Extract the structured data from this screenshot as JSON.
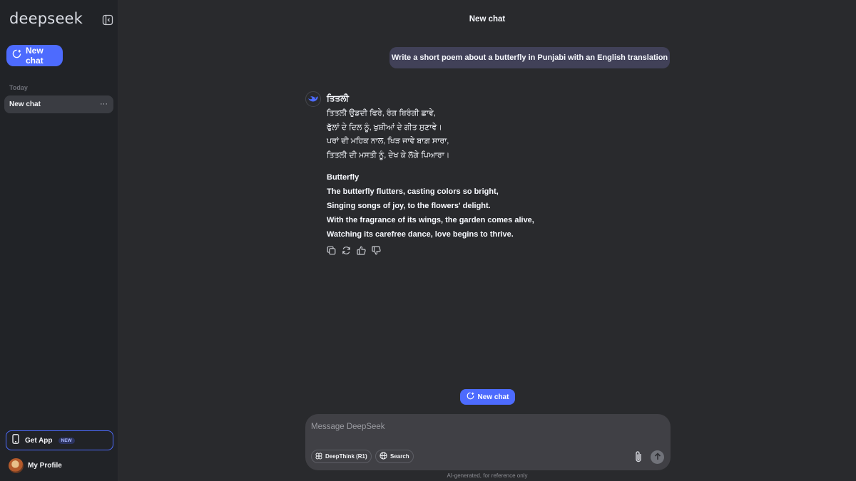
{
  "sidebar": {
    "logo": "deepseek",
    "new_chat_label": "New chat",
    "section_today": "Today",
    "history": [
      {
        "label": "New chat",
        "more": "···"
      }
    ],
    "get_app_label": "Get App",
    "get_app_badge": "NEW",
    "profile_label": "My Profile"
  },
  "header": {
    "title": "New chat"
  },
  "conversation": {
    "user_message": "Write a short poem about a butterfly in Punjabi with an English translation",
    "answer": {
      "punjabi_title": "ਤਿਤਲੀ",
      "punjabi_lines": [
        "ਤਿਤਲੀ ਉਡਦੀ ਫਿਰੇ, ਰੰਗ ਬਿਰੰਗੀ ਛਾਵੇ,",
        "ਫੁੱਲਾਂ ਦੇ ਦਿਲ ਨੂੰ, ਖੁਸ਼ੀਆਂ ਦੇ ਗੀਤ ਸੁਣਾਵੇ।",
        "ਪਰਾਂ ਦੀ ਮਹਿਕ ਨਾਲ, ਖਿੜ ਜਾਵੇ ਬਾਗ਼ ਸਾਰਾ,",
        "ਤਿਤਲੀ ਦੀ ਮਸਤੀ ਨੂੰ, ਦੇਖ ਕੇ ਲੱਗੇ ਪਿਆਰਾ।"
      ],
      "english_title": "Butterfly",
      "english_lines": [
        "The butterfly flutters, casting colors so bright,",
        "Singing songs of joy, to the flowers' delight.",
        "With the fragrance of its wings, the garden comes alive,",
        "Watching its carefree dance, love begins to thrive."
      ]
    },
    "actions": [
      "copy-icon",
      "regenerate-icon",
      "thumbs-up-icon",
      "thumbs-down-icon"
    ]
  },
  "floating_new_chat_label": "New chat",
  "composer": {
    "placeholder": "Message DeepSeek",
    "value": "",
    "deepthink_label": "DeepThink (R1)",
    "search_label": "Search"
  },
  "disclaimer": "AI-generated, for reference only",
  "colors": {
    "accent": "#4d6bfe",
    "background": "#292a2d",
    "sidebar": "#212327",
    "user_bubble": "#414158",
    "composer": "#404045"
  }
}
